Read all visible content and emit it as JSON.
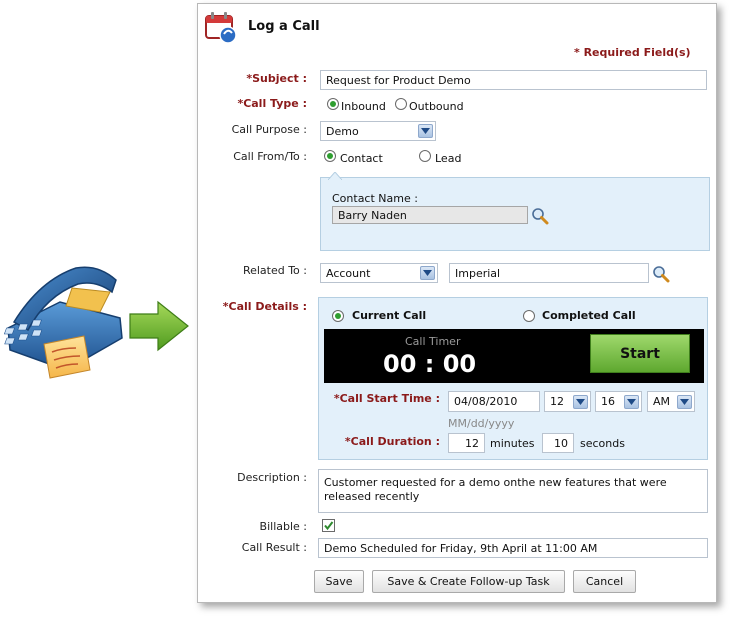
{
  "dialog": {
    "title": "Log a Call",
    "required_note": "* Required Field(s)"
  },
  "subject": {
    "label": "*Subject :",
    "value": "Request for Product Demo"
  },
  "call_type": {
    "label": "*Call Type :",
    "options": [
      "Inbound",
      "Outbound"
    ],
    "selected": "Inbound"
  },
  "call_purpose": {
    "label": "Call Purpose :",
    "value": "Demo"
  },
  "call_from_to": {
    "label": "Call From/To :",
    "options": [
      "Contact",
      "Lead"
    ],
    "selected": "Contact",
    "contact_name_label": "Contact Name :",
    "contact_name_value": "Barry Naden"
  },
  "related_to": {
    "label": "Related To :",
    "type_value": "Account",
    "value": "Imperial"
  },
  "call_details": {
    "label": "*Call Details :",
    "options": [
      "Current Call",
      "Completed Call"
    ],
    "selected": "Current Call",
    "timer_label": "Call Timer",
    "timer_value": "00 : 00",
    "start_button": "Start",
    "start_time_label": "*Call Start Time :",
    "date": "04/08/2010",
    "date_format": "MM/dd/yyyy",
    "hour": "12",
    "minute": "16",
    "ampm": "AM",
    "duration_label": "*Call Duration :",
    "duration_minutes": "12",
    "minutes_label": "minutes",
    "duration_seconds": "10",
    "seconds_label": "seconds"
  },
  "description": {
    "label": "Description :",
    "line1": "Customer requested for a demo onthe new features that were",
    "line2": "released  recently"
  },
  "billable": {
    "label": "Billable :",
    "checked": true
  },
  "call_result": {
    "label": "Call Result :",
    "value": "Demo Scheduled for Friday, 9th April at 11:00 AM"
  },
  "buttons": {
    "save": "Save",
    "save_follow_up": "Save & Create Follow-up Task",
    "cancel": "Cancel"
  },
  "colors": {
    "required": "#8b1a1a",
    "panel_bg": "#e3f0fa",
    "timer_bg": "#000000",
    "start_green": "#7cc24a"
  },
  "icons": [
    "phone-icon",
    "arrow-right-icon",
    "calendar-phone-icon",
    "search-icon",
    "chevron-down-icon",
    "checkbox-checked-icon"
  ]
}
